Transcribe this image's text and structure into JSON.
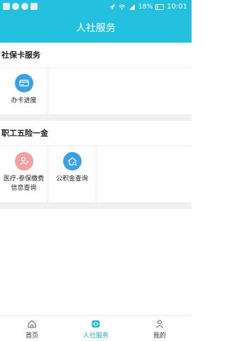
{
  "status": {
    "battery": "18%",
    "time": "10:01"
  },
  "header": {
    "title": "人社服务"
  },
  "sections": [
    {
      "title": "社保卡服务",
      "items": [
        {
          "label": "办卡进度",
          "icon": "card-progress-icon"
        }
      ]
    },
    {
      "title": "职工五险一金",
      "items": [
        {
          "label": "医疗-参保缴费信息查询",
          "icon": "medical-insurance-icon"
        },
        {
          "label": "公积金查询",
          "icon": "housing-fund-icon"
        }
      ]
    }
  ],
  "tabs": [
    {
      "label": "首页",
      "icon": "home-icon"
    },
    {
      "label": "人社服务",
      "icon": "service-icon",
      "active": true
    },
    {
      "label": "我的",
      "icon": "user-icon"
    }
  ],
  "colors": {
    "accent": "#24c0e0",
    "icon_blue": "#3aa0e8",
    "icon_pink": "#f3a0a0"
  }
}
